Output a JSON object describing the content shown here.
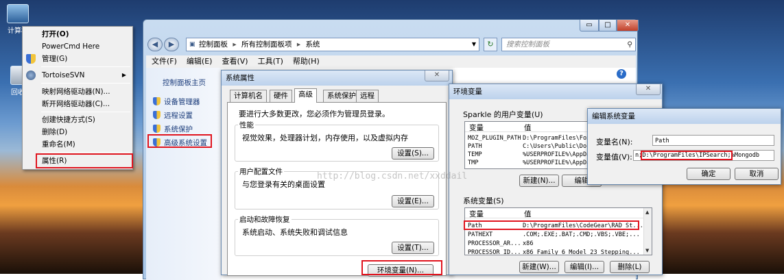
{
  "desktop": {
    "icons": [
      {
        "label": "计算机"
      },
      {
        "label": "回收"
      }
    ]
  },
  "context_menu": {
    "items": [
      {
        "label": "打开(O)",
        "bold": true
      },
      {
        "label": "PowerCmd Here"
      },
      {
        "label": "管理(G)"
      },
      {
        "label": "TortoiseSVN",
        "submenu": true
      },
      {
        "label": "映射网络驱动器(N)..."
      },
      {
        "label": "断开网络驱动器(C)..."
      },
      {
        "label": "创建快捷方式(S)"
      },
      {
        "label": "删除(D)"
      },
      {
        "label": "重命名(M)"
      },
      {
        "label": "属性(R)"
      }
    ]
  },
  "explorer": {
    "controls": {
      "minimize": "▭",
      "maximize": "□",
      "close": "✕"
    },
    "breadcrumb": [
      "控制面板",
      "所有控制面板项",
      "系统"
    ],
    "search_placeholder": "搜索控制面板",
    "menu": [
      "文件(F)",
      "编辑(E)",
      "查看(V)",
      "工具(T)",
      "帮助(H)"
    ],
    "sidebar": {
      "home": "控制面板主页",
      "items": [
        {
          "label": "设备管理器"
        },
        {
          "label": "远程设置"
        },
        {
          "label": "系统保护"
        },
        {
          "label": "高级系统设置"
        }
      ]
    }
  },
  "sys_props": {
    "title": "系统属性",
    "tabs": [
      "计算机名",
      "硬件",
      "高级",
      "系统保护",
      "远程"
    ],
    "active_tab": "高级",
    "intro": "要进行大多数更改，您必须作为管理员登录。",
    "groups": [
      {
        "title": "性能",
        "desc": "视觉效果，处理器计划，内存使用，以及虚拟内存",
        "button": "设置(S)..."
      },
      {
        "title": "用户配置文件",
        "desc": "与您登录有关的桌面设置",
        "button": "设置(E)..."
      },
      {
        "title": "启动和故障恢复",
        "desc": "系统启动、系统失败和调试信息",
        "button": "设置(T)..."
      }
    ],
    "env_button": "环境变量(N)..."
  },
  "env_vars": {
    "title": "环境变量",
    "user_group": "Sparkle 的用户变量(U)",
    "col_var": "变量",
    "col_val": "值",
    "user_rows": [
      {
        "name": "MOZ_PLUGIN_PATH",
        "value": "D:\\ProgramFiles\\Fox"
      },
      {
        "name": "PATH",
        "value": "C:\\Users\\Public\\Doc"
      },
      {
        "name": "TEMP",
        "value": "%USERPROFILE%\\AppDa"
      },
      {
        "name": "TMP",
        "value": "%USERPROFILE%\\AppDa"
      }
    ],
    "user_buttons": [
      "新建(N)...",
      "编辑"
    ],
    "sys_group": "系统变量(S)",
    "sys_rows": [
      {
        "name": "Path",
        "value": "D:\\ProgramFiles\\CodeGear\\RAD St..."
      },
      {
        "name": "PATHEXT",
        "value": ".COM;.EXE;.BAT;.CMD;.VBS;.VBE;..."
      },
      {
        "name": "PROCESSOR_AR...",
        "value": "x86"
      },
      {
        "name": "PROCESSOR_ID...",
        "value": "x86 Family 6 Model 23 Stepping..."
      }
    ],
    "sys_buttons": [
      "新建(W)...",
      "编辑(I)...",
      "删除(L)"
    ]
  },
  "edit_var": {
    "title": "编辑系统变量",
    "name_label": "变量名(N):",
    "name_value": "Path",
    "value_label": "变量值(V):",
    "value_prefix": "n;",
    "value_highlight": "D:\\ProgramFiles\\IPSearch;",
    "value_suffix": "%Mongodb",
    "ok": "确定",
    "cancel": "取消"
  },
  "watermark": "http://blog.csdn.net/xxddail"
}
